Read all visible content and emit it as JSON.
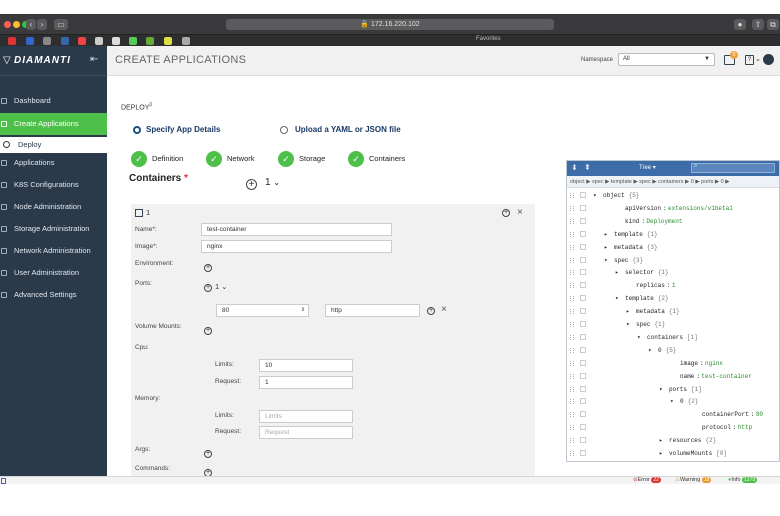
{
  "browser": {
    "url": "172.16.220.102",
    "favorites_label": "Favorites"
  },
  "app": {
    "logo_text": "DIAMANTI",
    "page_title": "CREATE APPLICATIONS",
    "namespace_label": "Namespace",
    "namespace_value": "All",
    "notification_count": "0"
  },
  "sidebar": {
    "items": [
      {
        "label": "Dashboard"
      },
      {
        "label": "Create Applications"
      },
      {
        "label": "Deploy"
      },
      {
        "label": "Applications"
      },
      {
        "label": "K8S Configurations"
      },
      {
        "label": "Node Administration"
      },
      {
        "label": "Storage Administration"
      },
      {
        "label": "Network Administration"
      },
      {
        "label": "User Administration"
      },
      {
        "label": "Advanced Settings"
      }
    ]
  },
  "deploy": {
    "title": "DEPLOY",
    "beta": "β",
    "option_specify": "Specify App Details",
    "option_upload": "Upload a YAML or JSON file",
    "steps": [
      "Definition",
      "Network",
      "Storage",
      "Containers"
    ],
    "containers_title": "Containers",
    "required_mark": "*",
    "container_count": "1"
  },
  "container": {
    "index": "1",
    "name_label": "Name*:",
    "name_value": "test-container",
    "image_label": "Image*:",
    "image_value": "nginx",
    "env_label": "Environment:",
    "ports_label": "Ports:",
    "ports_count": "1",
    "port_value": "80",
    "protocol_value": "http",
    "volume_label": "Volume Mounts:",
    "cpu_label": "Cpu:",
    "limits_label": "Limits:",
    "request_label": "Request:",
    "cpu_limits": "10",
    "cpu_request": "1",
    "memory_label": "Memory:",
    "mem_limits_placeholder": "Limits",
    "mem_request_placeholder": "Request",
    "args_label": "Args:",
    "commands_label": "Commands:"
  },
  "tree": {
    "mode": "Tree",
    "path": "object ▶ spec ▶ template ▶ spec ▶ containers ▶ 0 ▶ ports ▶ 0 ▶",
    "rows": [
      {
        "key": "object",
        "val": "{5}"
      },
      {
        "key": "apiVersion",
        "val": "extensions/v1beta1"
      },
      {
        "key": "kind",
        "val": "Deployment"
      },
      {
        "key": "template",
        "val": "{1}"
      },
      {
        "key": "metadata",
        "val": "{3}"
      },
      {
        "key": "spec",
        "val": "{3}"
      },
      {
        "key": "selector",
        "val": "{1}"
      },
      {
        "key": "replicas",
        "val": "1"
      },
      {
        "key": "template",
        "val": "{2}"
      },
      {
        "key": "metadata",
        "val": "{1}"
      },
      {
        "key": "spec",
        "val": "{1}"
      },
      {
        "key": "containers",
        "val": "[1]"
      },
      {
        "key": "0",
        "val": "{5}"
      },
      {
        "key": "image",
        "val": "nginx"
      },
      {
        "key": "name",
        "val": "test-container"
      },
      {
        "key": "ports",
        "val": "[1]"
      },
      {
        "key": "0",
        "val": "{2}"
      },
      {
        "key": "containerPort",
        "val": "80"
      },
      {
        "key": "protocol",
        "val": "http"
      },
      {
        "key": "resources",
        "val": "{2}"
      },
      {
        "key": "volumeMounts",
        "val": "[0]"
      }
    ]
  },
  "status": {
    "error_label": "Error",
    "error_count": "22",
    "warning_label": "Warning",
    "warning_count": "18",
    "info_label": "Info",
    "info_count": "1279"
  },
  "colors": {
    "sidebar": "#2b3a4b",
    "accent": "#4ec04a",
    "tree_header": "#3c6da8"
  }
}
